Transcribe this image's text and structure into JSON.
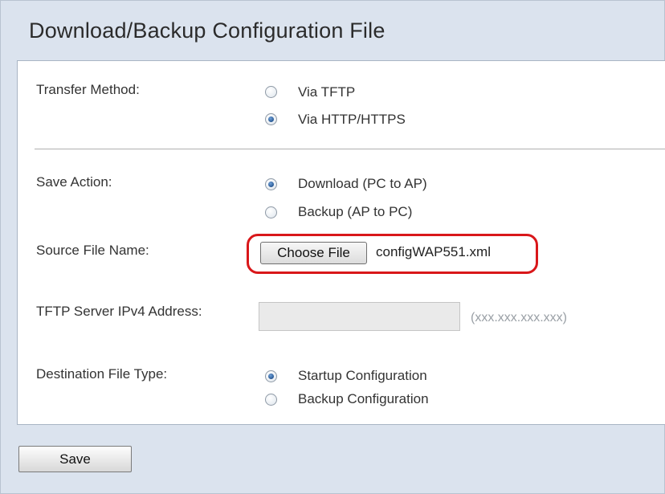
{
  "page": {
    "title": "Download/Backup Configuration File"
  },
  "transfer_method": {
    "label": "Transfer Method:",
    "options": [
      {
        "label": "Via TFTP",
        "checked": false
      },
      {
        "label": "Via HTTP/HTTPS",
        "checked": true
      }
    ]
  },
  "save_action": {
    "label": "Save Action:",
    "options": [
      {
        "label": "Download (PC to AP)",
        "checked": true
      },
      {
        "label": "Backup (AP to PC)",
        "checked": false
      }
    ]
  },
  "source_file": {
    "label": "Source File Name:",
    "button_label": "Choose File",
    "file_name": "configWAP551.xml"
  },
  "tftp_server": {
    "label": "TFTP Server IPv4 Address:",
    "value": "",
    "hint": "(xxx.xxx.xxx.xxx)"
  },
  "destination_type": {
    "label": "Destination File Type:",
    "options": [
      {
        "label": "Startup Configuration",
        "checked": true
      },
      {
        "label": "Backup Configuration",
        "checked": false
      }
    ]
  },
  "footer": {
    "save_label": "Save"
  },
  "colors": {
    "highlight": "#d9171a",
    "background": "#dbe3ee"
  }
}
